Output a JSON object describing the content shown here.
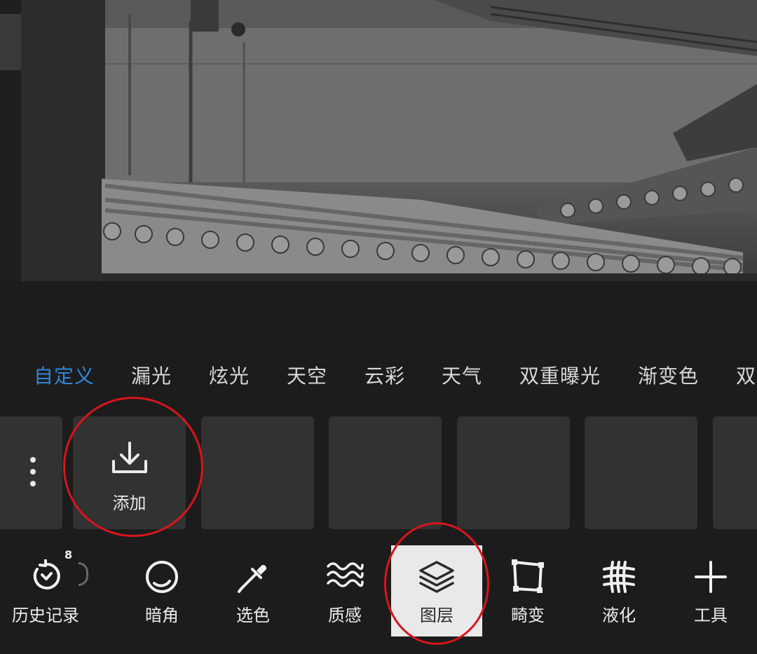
{
  "categories": {
    "items": [
      "自定义",
      "漏光",
      "炫光",
      "天空",
      "云彩",
      "天气",
      "双重曝光",
      "渐变色",
      "双"
    ],
    "active_index": 0
  },
  "thumbnails": {
    "add_label": "添加"
  },
  "toolbar": {
    "history": {
      "label": "历史记录",
      "badge": "8"
    },
    "vignette": {
      "label": "暗角"
    },
    "color_select": {
      "label": "选色"
    },
    "texture": {
      "label": "质感"
    },
    "layers": {
      "label": "图层"
    },
    "distort": {
      "label": "畸变"
    },
    "liquify": {
      "label": "液化"
    },
    "tools": {
      "label": "工具"
    },
    "selected": "layers"
  },
  "colors": {
    "background": "#1c1c1c",
    "accent": "#2f86d8",
    "thumb": "#323232",
    "annotation": "#d9141b",
    "selected_tool": "#e9e9e9"
  }
}
